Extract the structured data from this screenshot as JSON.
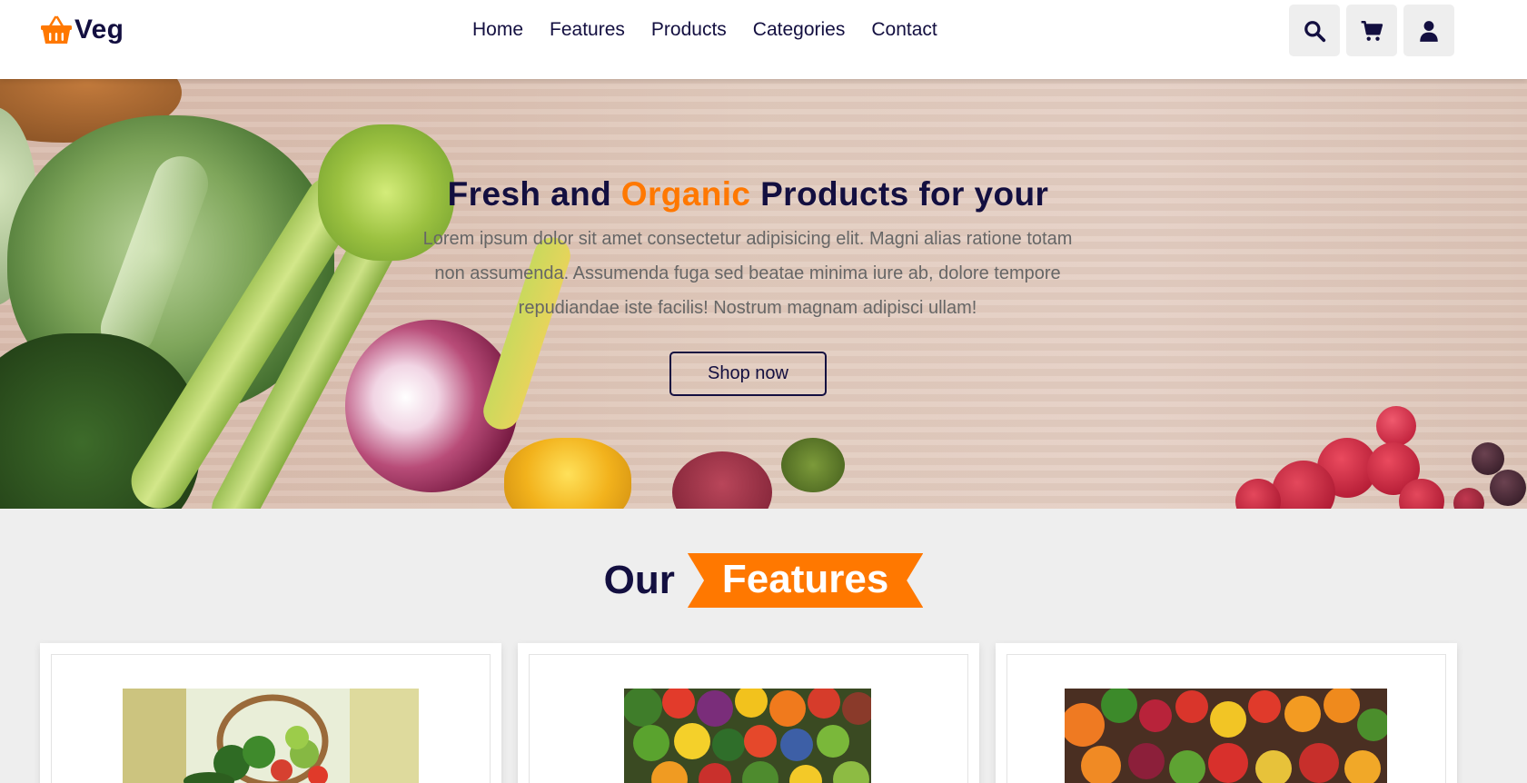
{
  "brand": {
    "name": "Veg",
    "icon": "shopping-basket-icon",
    "accent_color": "#ff7800",
    "text_color": "#130f40"
  },
  "nav": {
    "items": [
      {
        "label": "Home"
      },
      {
        "label": "Features"
      },
      {
        "label": "Products"
      },
      {
        "label": "Categories"
      },
      {
        "label": "Contact"
      }
    ]
  },
  "header_icons": [
    "search-icon",
    "cart-icon",
    "user-icon"
  ],
  "hero": {
    "title_part1": "Fresh and",
    "title_accent": "Organic",
    "title_part2": "Products for your",
    "text": "Lorem ipsum dolor sit amet consectetur adipisicing elit. Magni alias ratione totam non assumenda. Assumenda fuga sed beatae minima iure ab, dolore tempore repudiandae iste facilis! Nostrum magnam adipisci ullam!",
    "button_label": "Shop now"
  },
  "features": {
    "heading_plain": "Our",
    "heading_accent": "Features"
  }
}
